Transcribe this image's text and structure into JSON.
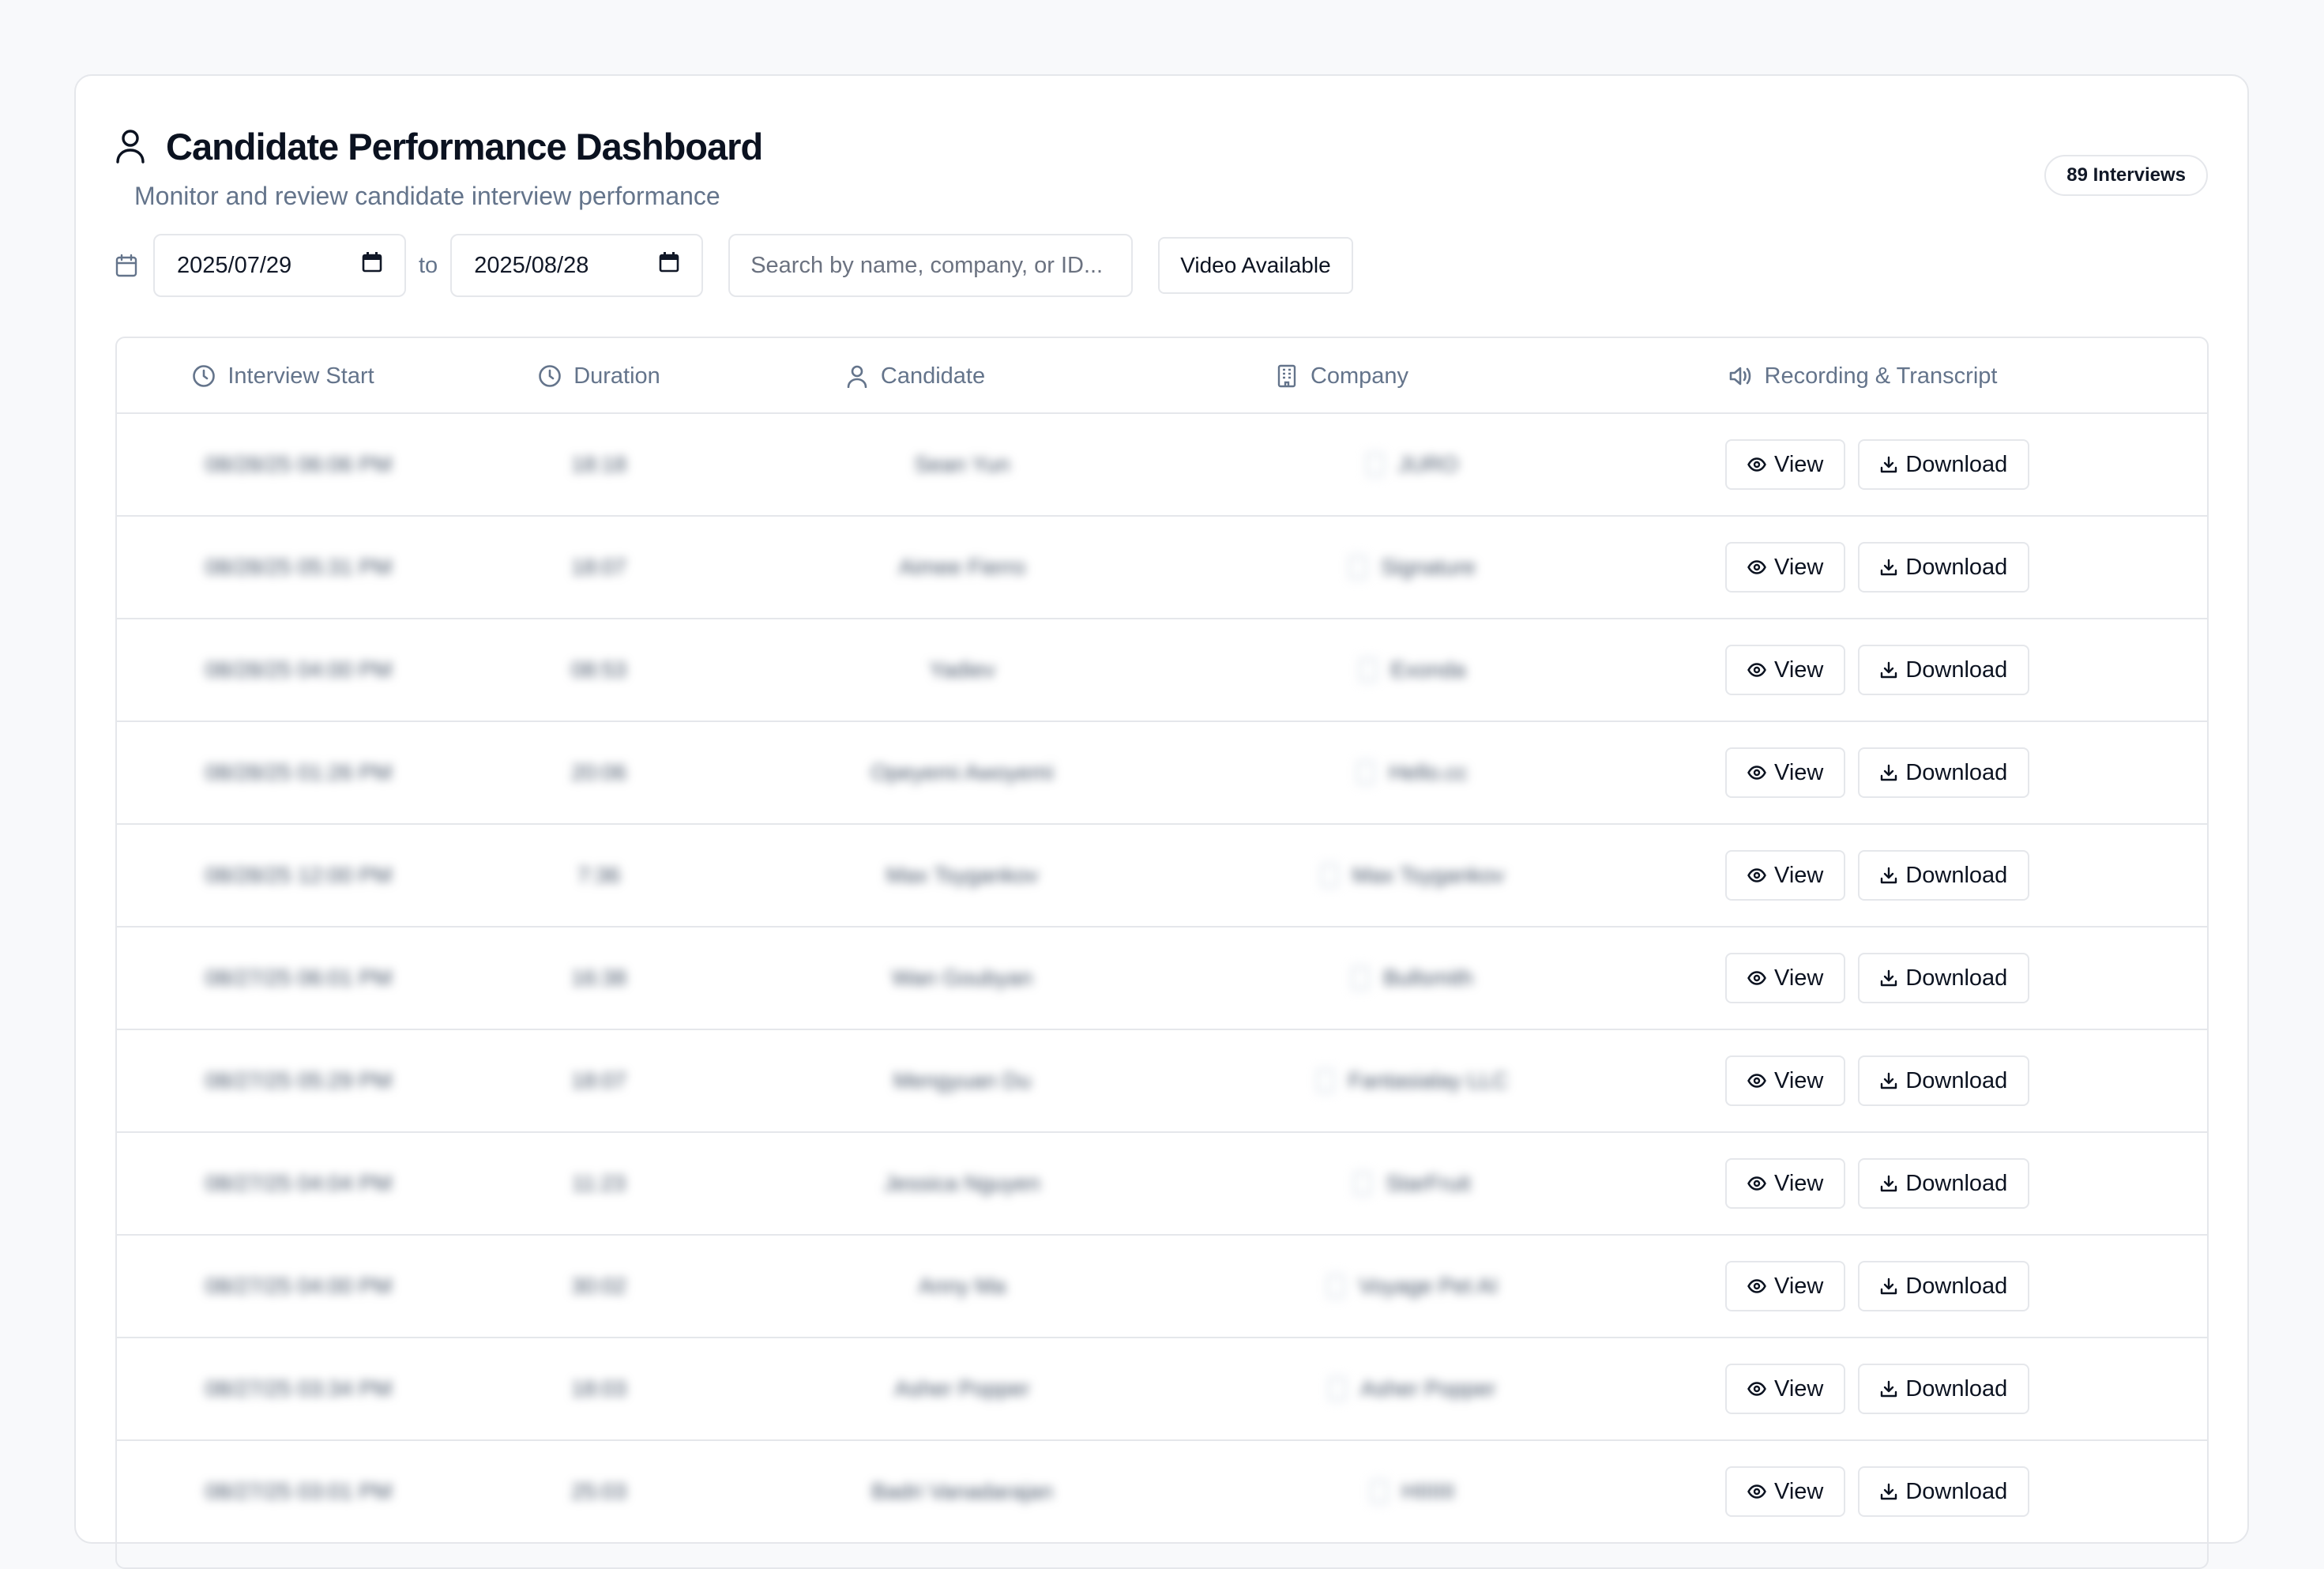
{
  "header": {
    "title": "Candidate Performance Dashboard",
    "subtitle": "Monitor and review candidate interview performance",
    "badge": "89 Interviews"
  },
  "filters": {
    "date_from": "2025/07/29",
    "to_label": "to",
    "date_to": "2025/08/28",
    "search_placeholder": "Search by name, company, or ID...",
    "video_filter_label": "Video Available"
  },
  "table": {
    "columns": [
      {
        "label": "Interview Start",
        "icon": "clock-icon"
      },
      {
        "label": "Duration",
        "icon": "clock-icon"
      },
      {
        "label": "Candidate",
        "icon": "user-icon"
      },
      {
        "label": "Company",
        "icon": "building-icon"
      },
      {
        "label": "Recording & Transcript",
        "icon": "speaker-icon"
      }
    ],
    "view_label": "View",
    "download_label": "Download",
    "rows": [
      {
        "start": "08/28/25 06:06 PM",
        "duration": "18:18",
        "candidate": "Sean Yun",
        "company": "JURO"
      },
      {
        "start": "08/28/25 05:31 PM",
        "duration": "18:07",
        "candidate": "Aimee Fierro",
        "company": "Signature"
      },
      {
        "start": "08/28/25 04:00 PM",
        "duration": "08:53",
        "candidate": "Yadiev",
        "company": "Exonda"
      },
      {
        "start": "08/28/25 01:26 PM",
        "duration": "20:06",
        "candidate": "Opeyemi Awoyemi",
        "company": "Hello.cc"
      },
      {
        "start": "08/28/25 12:00 PM",
        "duration": "7:36",
        "candidate": "Max Tsygankov",
        "company": "Max Tsygankov"
      },
      {
        "start": "08/27/25 06:01 PM",
        "duration": "16:38",
        "candidate": "Wan Goubyan",
        "company": "Bullsmith"
      },
      {
        "start": "08/27/25 05:29 PM",
        "duration": "18:07",
        "candidate": "Mengyuan Du",
        "company": "Fantasialay LLC"
      },
      {
        "start": "08/27/25 04:04 PM",
        "duration": "11:23",
        "candidate": "Jessica Nguyen",
        "company": "StarFruit"
      },
      {
        "start": "08/27/25 04:00 PM",
        "duration": "30:02",
        "candidate": "Anny Ma",
        "company": "Voyage Pet AI"
      },
      {
        "start": "08/27/25 03:34 PM",
        "duration": "18:03",
        "candidate": "Asher Popper",
        "company": "Asher Popper"
      },
      {
        "start": "08/27/25 03:01 PM",
        "duration": "25:03",
        "candidate": "Badri Vanadarajan",
        "company": "HIIIIII"
      }
    ]
  }
}
